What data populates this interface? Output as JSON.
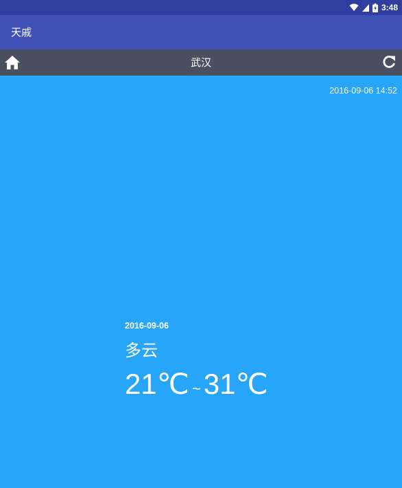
{
  "status_bar": {
    "time": "3:48",
    "icons": [
      "wifi-icon",
      "signal-icon",
      "battery-icon"
    ]
  },
  "app_bar": {
    "title": "天戚"
  },
  "toolbar": {
    "home_icon": "home-icon",
    "city": "武汉",
    "refresh_icon": "refresh-icon"
  },
  "weather": {
    "publish_time": "2016-09-06 14:52",
    "date": "2016-09-06",
    "description": "多云",
    "temp_low": "21℃",
    "temp_separator": "~",
    "temp_high": "31℃"
  },
  "colors": {
    "status_bar": "#303f9f",
    "app_bar": "#3f51b5",
    "toolbar": "#4a5060",
    "background": "#27a5f8",
    "text": "#ffffff"
  }
}
